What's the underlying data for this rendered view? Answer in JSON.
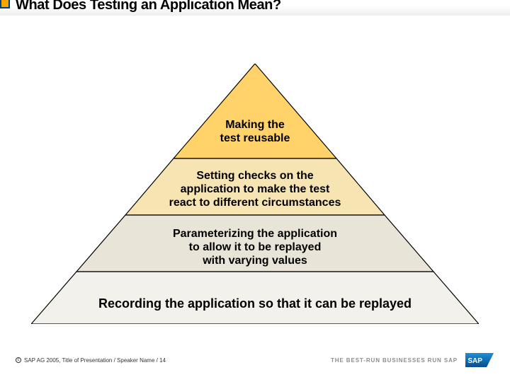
{
  "header": {
    "title": "What Does Testing an Application Mean?"
  },
  "pyramid": {
    "bands": [
      {
        "label": "Making the\ntest reusable"
      },
      {
        "label": "Setting checks on the\napplication to make the test\nreact to different circumstances"
      },
      {
        "label": "Parameterizing the application\nto allow it to be replayed\nwith varying values"
      },
      {
        "label": "Recording the application so that it can be replayed"
      }
    ],
    "colors": {
      "tier1": "#ffd26a",
      "tier2": "#f7e4b3",
      "tier3": "#e9e4d8",
      "tier4": "#f3f1ec",
      "outline": "#000000"
    }
  },
  "footer": {
    "copyright": "SAP AG 2005, Title of Presentation / Speaker Name / 14",
    "tagline": "THE BEST-RUN BUSINESSES RUN SAP",
    "logo_text": "SAP"
  }
}
